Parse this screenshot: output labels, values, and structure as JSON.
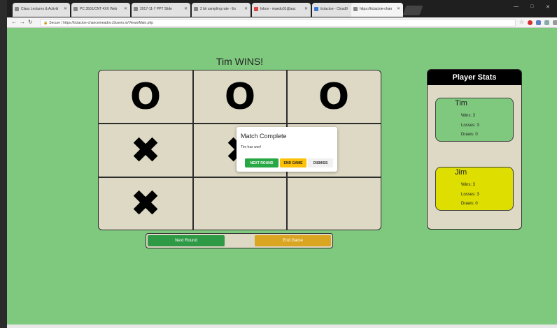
{
  "browser": {
    "tabs": [
      {
        "title": "Class Lectures & Activiti"
      },
      {
        "title": "PC 3501/CNT 4XX Web"
      },
      {
        "title": "2017-11-7 PPT Slide"
      },
      {
        "title": "2 bit sampling rate - Ex"
      },
      {
        "title": "Inbox - maedo31@auc"
      },
      {
        "title": "tictactoe - Cloud9"
      },
      {
        "title": "https://tictactoe-chan"
      }
    ],
    "url_secure": "Secure",
    "url": "https://tictactoe-chancemeador.c9users.io/Views/Main.php",
    "window_controls": [
      "—",
      "□",
      "✕"
    ]
  },
  "game": {
    "status": "Tim WINS!",
    "board": [
      "O",
      "O",
      "O",
      "✖",
      "✖",
      "",
      "✖",
      "",
      ""
    ]
  },
  "modal": {
    "title": "Match Complete",
    "message": "Tim has won!",
    "buttons": {
      "next": "NEXT ROUND",
      "end": "END GAME",
      "dismiss": "DISMISS"
    }
  },
  "controls": {
    "next": "Next Round",
    "end": "End Game"
  },
  "stats": {
    "header": "Player Stats",
    "players": [
      {
        "name": "Tim",
        "wins": "Wins: 3",
        "losses": "Losses: 3",
        "draws": "Draws: 0"
      },
      {
        "name": "Jim",
        "wins": "Wins: 3",
        "losses": "Losses: 3",
        "draws": "Draws: 0"
      }
    ]
  },
  "colors": {
    "page_bg": "#7fc97f",
    "board_bg": "#ddd9c4",
    "next_button": "#2e9a45",
    "end_button": "#daa520",
    "jim_card": "#dede00"
  }
}
